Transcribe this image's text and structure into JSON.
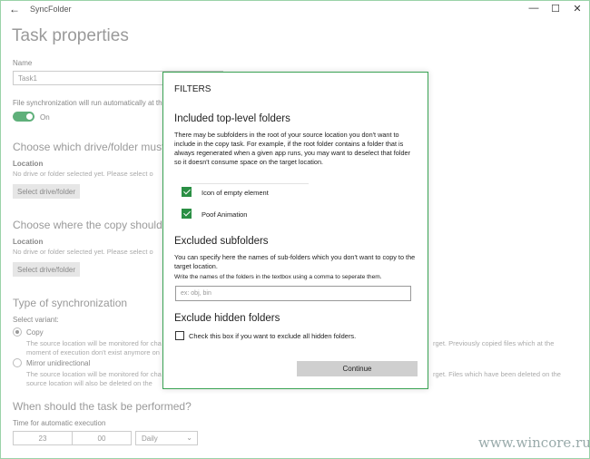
{
  "window": {
    "app_title": "SyncFolder",
    "back_glyph": "←",
    "minimize_glyph": "—",
    "maximize_glyph": "☐",
    "close_glyph": "✕"
  },
  "page": {
    "heading": "Task properties",
    "name_label": "Name",
    "name_value": "Task1",
    "auto_sync_text": "File synchronization will run automatically at th",
    "toggle_state": "On",
    "source_heading": "Choose which drive/folder must be",
    "source_location_label": "Location",
    "source_location_hint": "No drive or folder selected yet. Please select o",
    "source_select_button": "Select drive/folder",
    "target_heading": "Choose where the copy should be",
    "target_location_label": "Location",
    "target_location_hint": "No drive or folder selected yet. Please select o",
    "target_select_button": "Select drive/folder",
    "sync_type_heading": "Type of synchronization",
    "select_variant_label": "Select variant:",
    "copy_label": "Copy",
    "copy_desc_1": "The source location will be monitored for cha",
    "copy_desc_1_right": "rget. Previously copied files which at the",
    "copy_desc_2": "moment of execution don't exist anymore on",
    "mirror_label": "Mirror unidirectional",
    "mirror_desc_1": "The source location will be monitored for cha",
    "mirror_desc_1_right": "rget. Files which have been deleted on the",
    "mirror_desc_2": "source location will also be deleted on the",
    "when_heading": "When should the task be performed?",
    "time_label": "Time for automatic execution",
    "hour_value": "23",
    "minute_value": "00",
    "frequency_value": "Daily"
  },
  "watermark": "www.wincore.ru",
  "dialog": {
    "title": "FILTERS",
    "included_heading": "Included top-level folders",
    "included_desc": "There may be subfolders in the root of your source location you don't want to include in the copy task. For example, if the root folder contains a folder that is always regenerated when a given app runs, you may want to deselect that folder so it doesn't consume space on the target location.",
    "folders": [
      {
        "label": "Icon of empty element",
        "checked": true
      },
      {
        "label": "Poof Animation",
        "checked": true
      }
    ],
    "excluded_heading": "Excluded subfolders",
    "excluded_desc": "You can specify here the names of sub-folders which you don't want to copy to the target location.",
    "excluded_hint": "Write the names of the folders in the textbox using a comma to seperate them.",
    "excluded_placeholder": "ex: obj, bin",
    "hidden_heading": "Exclude hidden folders",
    "hidden_checkbox_label": "Check this box if you want to exclude all hidden folders.",
    "continue_button": "Continue"
  },
  "colors": {
    "accent": "#2a8f44",
    "window_border": "#9ad3a8"
  }
}
